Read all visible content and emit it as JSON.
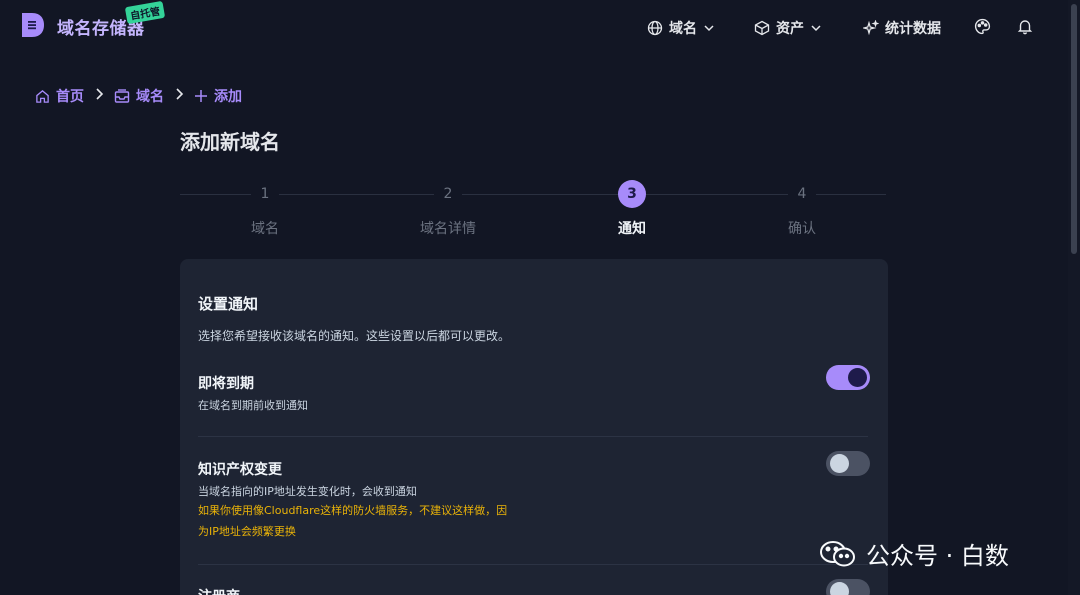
{
  "header": {
    "brand": "域名存储器",
    "badge": "自托管",
    "nav": [
      {
        "label": "域名",
        "icon": "globe-icon"
      },
      {
        "label": "资产",
        "icon": "cube-icon"
      },
      {
        "label": "统计数据",
        "icon": "sparkles-icon"
      }
    ]
  },
  "breadcrumb": {
    "home": "首页",
    "domains": "域名",
    "add": "添加"
  },
  "page": {
    "title": "添加新域名"
  },
  "stepper": {
    "steps": [
      {
        "num": "1",
        "label": "域名"
      },
      {
        "num": "2",
        "label": "域名详情"
      },
      {
        "num": "3",
        "label": "通知"
      },
      {
        "num": "4",
        "label": "确认"
      }
    ],
    "active_step": 3
  },
  "card": {
    "title": "设置通知",
    "description": "选择您希望接收该域名的通知。这些设置以后都可以更改。",
    "settings": [
      {
        "title": "即将到期",
        "description": "在域名到期前收到通知",
        "enabled": true
      },
      {
        "title": "知识产权变更",
        "description": "当域名指向的IP地址发生变化时，会收到通知",
        "warning": "如果你使用像Cloudflare这样的防火墙服务，不建议这样做，因为IP地址会频繁更换",
        "enabled": false
      },
      {
        "title": "注册商",
        "enabled": false
      }
    ]
  },
  "watermark": {
    "text": "公众号 · 白数"
  },
  "colors": {
    "accent": "#a78bfa",
    "background": "#121624",
    "card": "#1e2433",
    "warning": "#eab308"
  }
}
